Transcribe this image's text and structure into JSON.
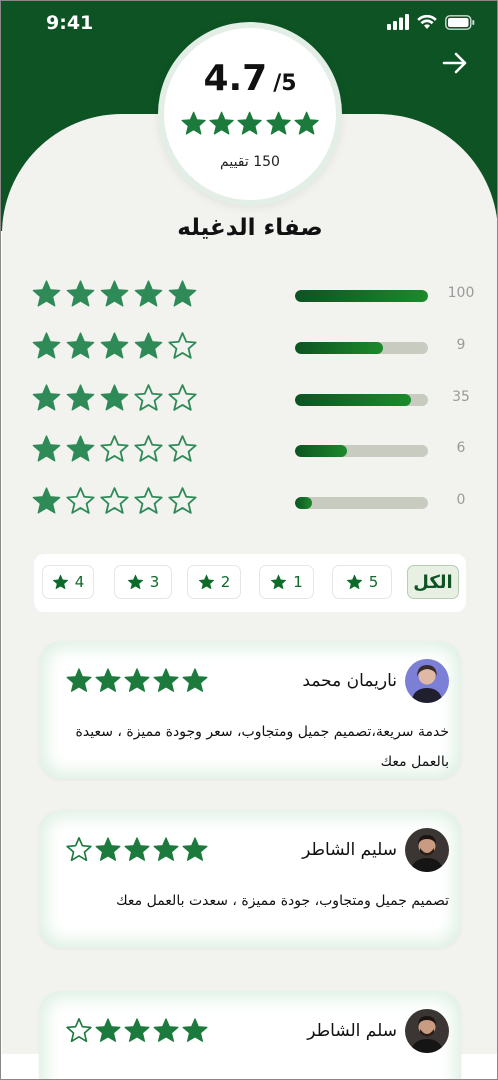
{
  "status_bar": {
    "time": "9:41"
  },
  "rating": {
    "score": "4.7",
    "out_of": "/5",
    "count_text": "150 تقييم",
    "stars_filled": 5
  },
  "person_name": "صفاء الدغيله",
  "distribution": [
    {
      "stars": 5,
      "count": "100",
      "fill": 1.0
    },
    {
      "stars": 4,
      "count": "9",
      "fill": 0.66
    },
    {
      "stars": 3,
      "count": "35",
      "fill": 0.87
    },
    {
      "stars": 2,
      "count": "6",
      "fill": 0.39
    },
    {
      "stars": 1,
      "count": "0",
      "fill": 0.13
    }
  ],
  "filters": [
    {
      "label": "الكل",
      "active": true
    },
    {
      "label": "5"
    },
    {
      "label": "1"
    },
    {
      "label": "2"
    },
    {
      "label": "3"
    },
    {
      "label": "4"
    }
  ],
  "reviews": [
    {
      "name": "ناريمان محمد",
      "stars": 5,
      "text": "خدمة سريعة،تصميم جميل ومتجاوب، سعر وجودة مميزة ، سعيدة بالعمل معك",
      "avatar": "woman-avatar"
    },
    {
      "name": "سليم الشاطر",
      "stars": 4,
      "text": "تصميم جميل ومتجاوب، جودة مميزة ، سعدت بالعمل معك",
      "avatar": "man-avatar"
    },
    {
      "name": "سلم الشاطر",
      "stars": 4,
      "text": "",
      "avatar": "man-avatar"
    }
  ],
  "colors": {
    "header": "#0d5323",
    "star": "#1c7a3c",
    "bar_track": "#c8cbc0",
    "sheet": "#f2f2ef"
  },
  "icons": [
    "signal-icon",
    "wifi-icon",
    "battery-icon",
    "arrow-right-icon",
    "star-icon"
  ]
}
